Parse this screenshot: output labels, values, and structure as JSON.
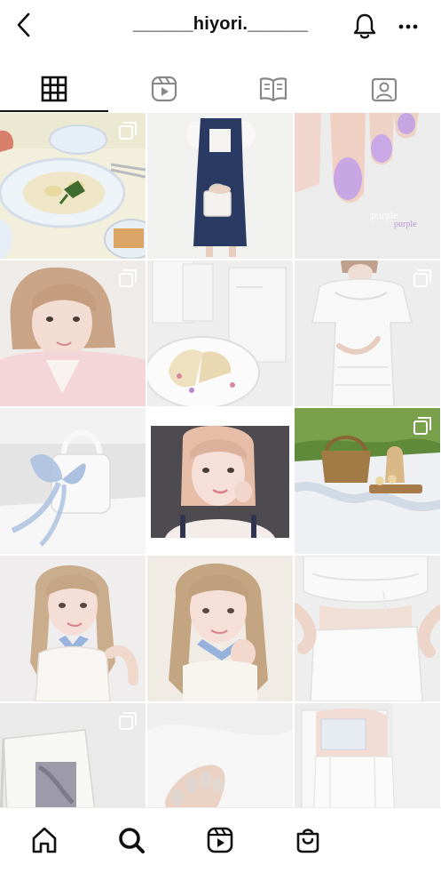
{
  "header": {
    "title": "______hiyori.______",
    "back_icon": "back-arrow-icon",
    "notification_icon": "bell-icon",
    "more_icon": "more-dots-icon"
  },
  "tabs": [
    {
      "name": "posts-grid",
      "icon": "grid-icon",
      "selected": true
    },
    {
      "name": "reels",
      "icon": "reels-icon",
      "selected": false
    },
    {
      "name": "guides",
      "icon": "guide-book-icon",
      "selected": false
    },
    {
      "name": "tagged",
      "icon": "tagged-person-icon",
      "selected": false
    }
  ],
  "posts": [
    {
      "subject": "pasta dish on table",
      "multi": true
    },
    {
      "subject": "navy pinafore dress with white bag",
      "multi": false
    },
    {
      "subject": "lavender nails",
      "multi": false,
      "caption_main": "purple",
      "caption_sub": "purple"
    },
    {
      "subject": "selfie with pink cardigan",
      "multi": true
    },
    {
      "subject": "cosmetics and cake on plate",
      "multi": false
    },
    {
      "subject": "white puff sleeve dress",
      "multi": true
    },
    {
      "subject": "white bag with blue ribbon",
      "multi": false
    },
    {
      "subject": "framed selfie",
      "multi": false
    },
    {
      "subject": "picnic on grass",
      "multi": true
    },
    {
      "subject": "portrait with braids and blue scarf",
      "multi": false
    },
    {
      "subject": "portrait with braids close-up",
      "multi": false
    },
    {
      "subject": "white crop top and skirt",
      "multi": false
    },
    {
      "subject": "magazine page",
      "multi": true
    },
    {
      "subject": "nude nails on white fabric",
      "multi": false
    },
    {
      "subject": "white outfit in mirror",
      "multi": false
    }
  ],
  "bottom_nav": [
    {
      "name": "home",
      "icon": "home-icon"
    },
    {
      "name": "search",
      "icon": "search-icon"
    },
    {
      "name": "reels",
      "icon": "reels-icon"
    },
    {
      "name": "shop",
      "icon": "shop-bag-icon"
    }
  ],
  "colors": {
    "background": "#ffffff",
    "text": "#111111",
    "indicator": "#111111"
  }
}
